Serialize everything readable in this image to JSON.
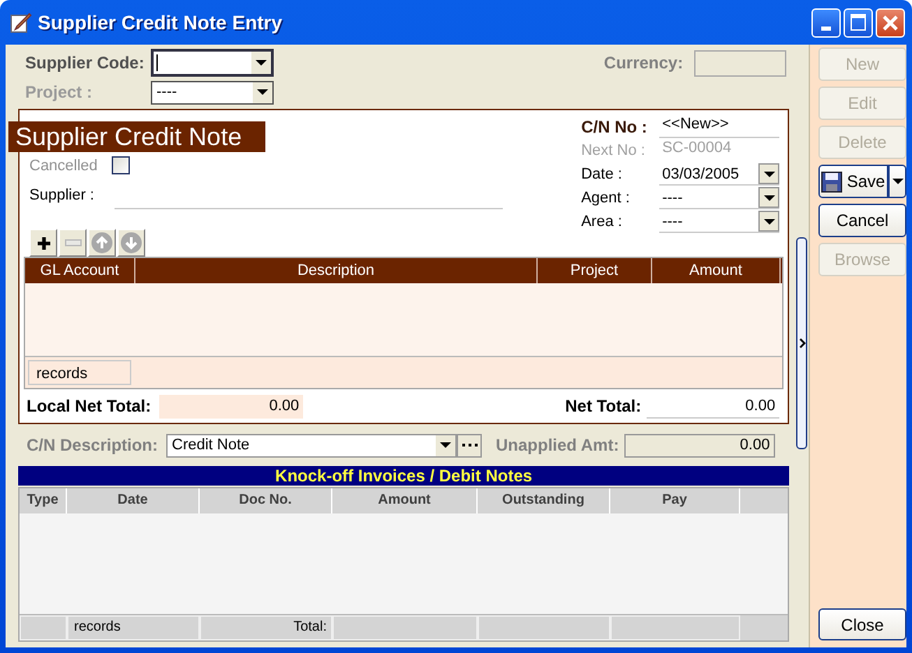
{
  "window": {
    "title": "Supplier Credit Note Entry"
  },
  "header": {
    "supplier_code": {
      "label": "Supplier Code:"
    },
    "project": {
      "label": "Project :",
      "value": "----"
    },
    "currency": {
      "label": "Currency:"
    }
  },
  "form": {
    "title": "Supplier Credit Note",
    "cancelled": {
      "label": "Cancelled",
      "checked": false
    },
    "supplier": {
      "label": "Supplier :"
    },
    "fields": [
      {
        "label": "C/N No :",
        "value": "<<New>>",
        "kind": "title"
      },
      {
        "label": "Next No :",
        "value": "SC-00004",
        "kind": "readonly"
      },
      {
        "label": "Date :",
        "value": "03/03/2005",
        "kind": "dropdown"
      },
      {
        "label": "Agent :",
        "value": "----",
        "kind": "dropdown"
      },
      {
        "label": "Area :",
        "value": "----",
        "kind": "dropdown"
      }
    ],
    "toolbar": [
      {
        "kind": "add",
        "disabled": false
      },
      {
        "kind": "remove",
        "disabled": true
      },
      {
        "kind": "up",
        "disabled": true
      },
      {
        "kind": "down",
        "disabled": true
      }
    ],
    "grid": {
      "columns": [
        "GL Account",
        "Description",
        "Project",
        "Amount"
      ],
      "footer": "records"
    },
    "local_net_total": {
      "label": "Local Net Total:",
      "value": "0.00"
    },
    "net_total": {
      "label": "Net Total:",
      "value": "0.00"
    }
  },
  "cn_description": {
    "label": "C/N Description:",
    "value": "Credit Note"
  },
  "unapplied": {
    "label": "Unapplied Amt:",
    "value": "0.00"
  },
  "knockoff": {
    "title": "Knock-off Invoices / Debit Notes",
    "columns": [
      "Type",
      "Date",
      "Doc No.",
      "Amount",
      "Outstanding",
      "Pay"
    ],
    "footer": [
      "records",
      "Total:"
    ]
  },
  "actions": [
    {
      "label": "New",
      "disabled": true,
      "kind": "plain"
    },
    {
      "label": "Edit",
      "disabled": true,
      "kind": "plain"
    },
    {
      "label": "Delete",
      "disabled": true,
      "kind": "plain"
    },
    {
      "label": "Save",
      "disabled": false,
      "kind": "split"
    },
    {
      "label": "Cancel",
      "disabled": false,
      "kind": "plain"
    },
    {
      "label": "Browse",
      "disabled": true,
      "kind": "plain"
    }
  ],
  "close_button": {
    "label": "Close"
  }
}
